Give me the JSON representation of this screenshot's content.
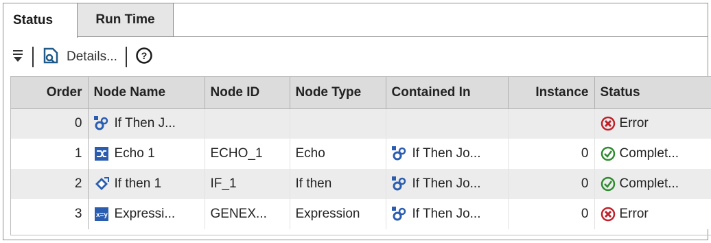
{
  "tabs": [
    {
      "label": "Status",
      "active": true
    },
    {
      "label": "Run Time",
      "active": false
    }
  ],
  "toolbar": {
    "filter_icon": "filter-icon",
    "details_icon": "details-icon",
    "details_label": "Details...",
    "help_icon": "help-icon"
  },
  "table": {
    "columns": [
      "Order",
      "Node Name",
      "Node ID",
      "Node Type",
      "Contained In",
      "Instance",
      "Status"
    ],
    "rows": [
      {
        "order": "0",
        "node_name": "If Then J...",
        "node_icon": "job-icon",
        "node_id": "",
        "node_type": "",
        "contained_in": "",
        "contained_icon": "",
        "instance": "",
        "status": "Error",
        "status_icon": "error-icon"
      },
      {
        "order": "1",
        "node_name": "Echo 1",
        "node_icon": "echo-icon",
        "node_id": "ECHO_1",
        "node_type": "Echo",
        "contained_in": "If Then Jo...",
        "contained_icon": "job-icon",
        "instance": "0",
        "status": "Complet...",
        "status_icon": "complete-icon"
      },
      {
        "order": "2",
        "node_name": "If then 1",
        "node_icon": "if-then-icon",
        "node_id": "IF_1",
        "node_type": "If then",
        "contained_in": "If Then Jo...",
        "contained_icon": "job-icon",
        "instance": "0",
        "status": "Complet...",
        "status_icon": "complete-icon"
      },
      {
        "order": "3",
        "node_name": "Expressi...",
        "node_icon": "expression-icon",
        "node_id": "GENEX...",
        "node_type": "Expression",
        "contained_in": "If Then Jo...",
        "contained_icon": "job-icon",
        "instance": "0",
        "status": "Error",
        "status_icon": "error-icon"
      }
    ]
  },
  "colors": {
    "error": "#c0202a",
    "complete": "#2e8b2e",
    "icon_blue": "#2a5db0"
  }
}
